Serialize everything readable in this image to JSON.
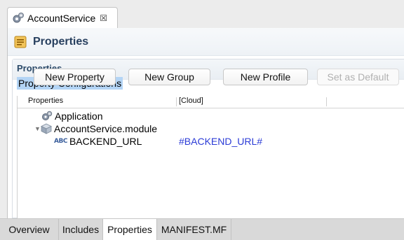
{
  "editor_tab": {
    "title": "AccountService",
    "close_glyph": "☒"
  },
  "form_header": {
    "title": "Properties",
    "icon": "properties-icon"
  },
  "section": {
    "title": "Properties",
    "description": "Property Configurations"
  },
  "buttons": {
    "new_property": "New Property",
    "new_group": "New Group",
    "new_profile": "New Profile",
    "set_default": "Set as Default"
  },
  "tree": {
    "columns": [
      "Properties",
      "[Cloud]"
    ],
    "rows": [
      {
        "label": "Application",
        "icon": "gears-icon"
      },
      {
        "label": "AccountService.module",
        "icon": "module-cube-icon",
        "expanded": true
      },
      {
        "label": "BACKEND_URL",
        "icon": "abc-text-icon",
        "icon_text": "ABC",
        "value": "#BACKEND_URL#"
      }
    ]
  },
  "page_tabs": [
    "Overview",
    "Includes",
    "Properties",
    "MANIFEST.MF"
  ],
  "active_page_tab": "Properties",
  "colors": {
    "value_blue": "#2b3bd6",
    "selection": "#b3d4f5",
    "header_text": "#28405f"
  }
}
